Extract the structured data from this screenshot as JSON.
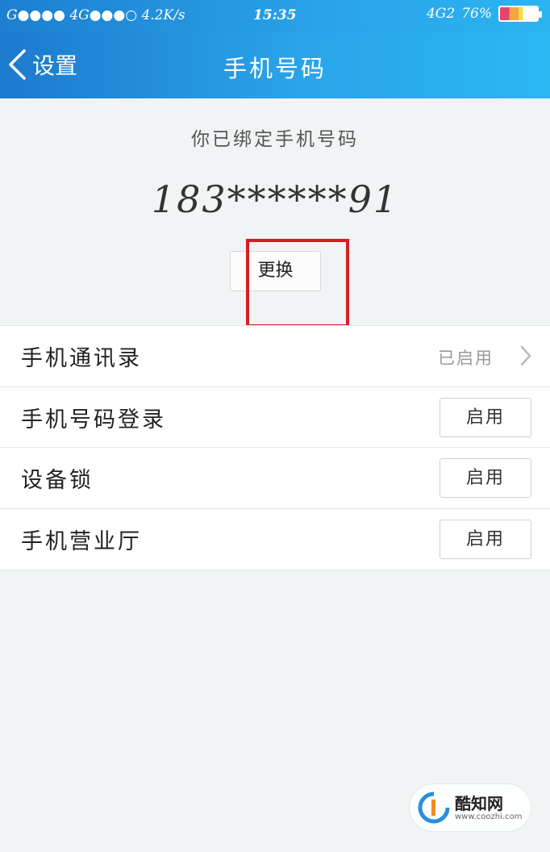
{
  "status_bar": {
    "left": "G●●●● 4G●●●○ 4.2K/s",
    "time": "15:35",
    "network2": "4G2",
    "battery": "76%"
  },
  "nav": {
    "back_label": "设置",
    "title": "手机号码"
  },
  "binding": {
    "label": "你已绑定手机号码",
    "phone": "183******91",
    "change_label": "更换"
  },
  "list": {
    "items": [
      {
        "label": "手机通讯录",
        "status": "已启用"
      },
      {
        "label": "手机号码登录",
        "button": "启用"
      },
      {
        "label": "设备锁",
        "button": "启用"
      },
      {
        "label": "手机营业厅",
        "button": "启用"
      }
    ]
  },
  "watermark": {
    "name": "酷知网",
    "url": "www.coozhi.com"
  },
  "colors": {
    "nav_blue": "#2aa4ea",
    "annotation_red": "#d81e25",
    "background": "#f1f4f5"
  }
}
